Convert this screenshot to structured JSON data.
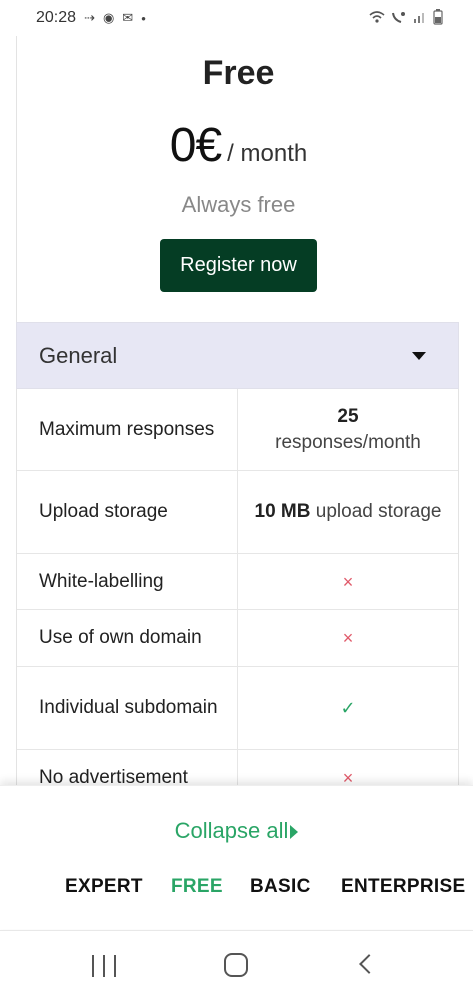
{
  "status_bar": {
    "time": "20:28",
    "left_icons": [
      "call-forward-icon",
      "record-icon",
      "mail-icon",
      "dot-icon"
    ],
    "right_icons": [
      "wifi-icon",
      "volte-icon",
      "signal-icon",
      "battery-icon"
    ]
  },
  "plan": {
    "name": "Free",
    "price": "0€",
    "period": "/ month",
    "tagline": "Always free",
    "register_label": "Register now"
  },
  "section": {
    "title": "General",
    "rows": [
      {
        "label": "Maximum responses",
        "value_bold": "25",
        "value_text": "responses/month",
        "type": "text"
      },
      {
        "label": "Upload storage",
        "value_bold": "10 MB",
        "value_text": "upload storage",
        "type": "text"
      },
      {
        "label": "White-labelling",
        "value_icon": "×",
        "type": "cross"
      },
      {
        "label": "Use of own domain",
        "value_icon": "×",
        "type": "cross"
      },
      {
        "label": "Individual subdomain",
        "value_icon": "✓",
        "type": "check"
      },
      {
        "label": "No advertisement",
        "value_icon": "×",
        "type": "cross"
      }
    ]
  },
  "bottom": {
    "collapse_label": "Collapse all",
    "tabs": [
      {
        "label": "EXPERT",
        "active": false
      },
      {
        "label": "FREE",
        "active": true
      },
      {
        "label": "BASIC",
        "active": false
      },
      {
        "label": "ENTERPRISE",
        "active": false
      }
    ]
  },
  "colors": {
    "accent": "#2aa566",
    "button_bg": "#053d24",
    "section_bg": "#e7e7f4",
    "cross": "#e05a6a"
  }
}
